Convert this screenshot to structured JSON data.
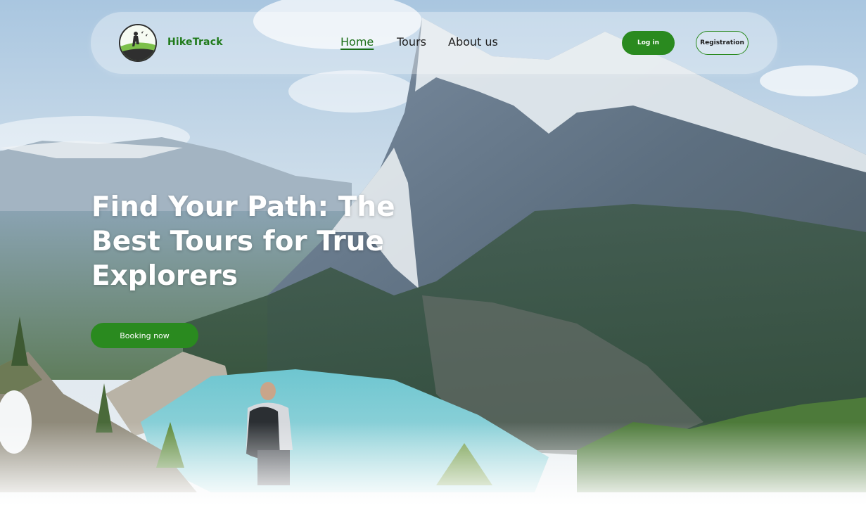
{
  "brand": {
    "name": "HikeTrack",
    "logo_icon": "hiker-logo-icon",
    "color": "#1f7a1a"
  },
  "nav": {
    "items": [
      {
        "label": "Home",
        "active": true
      },
      {
        "label": "Tours",
        "active": false
      },
      {
        "label": "About us",
        "active": false
      }
    ],
    "login_label": "Log in",
    "registration_label": "Registration"
  },
  "hero": {
    "headline": "Find Your Path: The Best Tours for True Explorers",
    "cta_label": "Booking now"
  },
  "colors": {
    "accent": "#2a8a1f",
    "active_link": "#1b6e17",
    "headline": "#ffffff"
  }
}
